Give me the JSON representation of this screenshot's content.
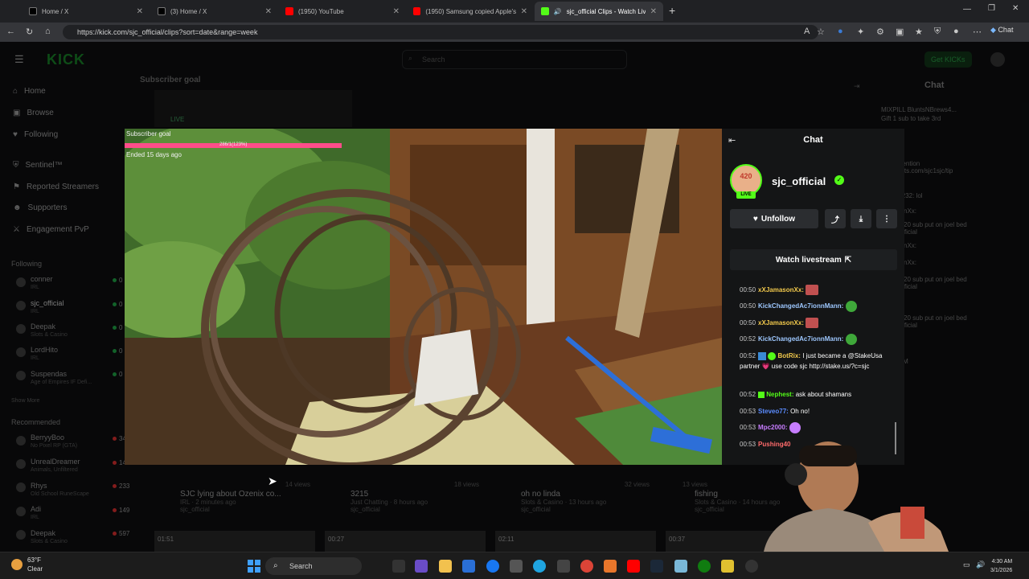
{
  "browser": {
    "tabs": [
      {
        "label": "Home / X"
      },
      {
        "label": "(3) Home / X"
      },
      {
        "label": "(1950) YouTube"
      },
      {
        "label": "(1950) Samsung copied Apple's w"
      },
      {
        "label": "sjc_official Clips - Watch Live"
      }
    ],
    "url": "https://kick.com/sjc_official/clips?sort=date&range=week",
    "chat_button": "Chat"
  },
  "kick": {
    "logo": "KICK",
    "search_placeholder": "Search",
    "get_kicks": "Get KICKs",
    "nav": [
      {
        "label": "Home"
      },
      {
        "label": "Browse"
      },
      {
        "label": "Following"
      },
      {
        "label": "Sentinel™"
      },
      {
        "label": "Reported Streamers"
      },
      {
        "label": "Supporters"
      },
      {
        "label": "Engagement PvP"
      }
    ],
    "following_header": "Following",
    "following": [
      {
        "name": "conner",
        "sub": "IRL",
        "count": "0"
      },
      {
        "name": "sjc_official",
        "sub": "IRL",
        "count": "0"
      },
      {
        "name": "Deepak",
        "sub": "Slots & Casino",
        "count": "0"
      },
      {
        "name": "LordHito",
        "sub": "IRL",
        "count": "0"
      },
      {
        "name": "Suspendas",
        "sub": "Age of Empires IF Defi...",
        "count": "0"
      }
    ],
    "show_more": "Show More",
    "recommended_header": "Recommended",
    "recommended": [
      {
        "name": "BerryyBoo",
        "sub": "No Pixel RP (GTA)",
        "count": "34"
      },
      {
        "name": "UnrealDreamer",
        "sub": "Animals, Unfiltered",
        "count": "14"
      },
      {
        "name": "Rhys",
        "sub": "Old School RuneScape",
        "count": "233"
      },
      {
        "name": "Adi",
        "sub": "IRL",
        "count": "149"
      },
      {
        "name": "Deepak",
        "sub": "Slots & Casino",
        "count": "597"
      }
    ],
    "subscriber_goal": "Subscriber goal",
    "live_badge": "LIVE",
    "right_chat_title": "Chat",
    "clips": [
      {
        "title": "SJC lying about Ozenix co...",
        "meta": "IRL · 2 minutes ago",
        "channel": "sjc_official",
        "views": "14 views",
        "duration": "01:51"
      },
      {
        "title": "3215",
        "meta": "Just Chatting · 8 hours ago",
        "channel": "sjc_official",
        "views": "18 views",
        "duration": "00:27"
      },
      {
        "title": "oh no linda",
        "meta": "Slots & Casino · 13 hours ago",
        "channel": "sjc_official",
        "views": "32 views",
        "duration": "02:11"
      },
      {
        "title": "fishing",
        "meta": "Slots & Casino · 14 hours ago",
        "channel": "sjc_official",
        "views": "13 views",
        "duration": "00:37"
      }
    ],
    "right_chat_lines": [
      {
        "text": "MIXPILL  BluntsNBrews4..."
      },
      {
        "text": "Gift 1 sub to take 3rd"
      },
      {
        "text": "BotRix:"
      },
      {
        "text": "sjc's attention"
      },
      {
        "text": "relements.com/sjc1sjc/tip"
      },
      {
        "text": "CGmer232: lol"
      },
      {
        "text": "JamesonXx:"
      },
      {
        "text": "R0004: 20 sub put on joel bed"
      },
      {
        "text": "@sjc_official"
      },
      {
        "text": "JamesonXx:"
      },
      {
        "text": "JamesonXx:"
      },
      {
        "text": "R0004: 20 sub put on joel bed"
      },
      {
        "text": "@sjc_official"
      },
      {
        "text": "R0004: 20 sub put on joel bed"
      },
      {
        "text": "@sjc_official"
      },
      {
        "text": "04:30 AM"
      }
    ]
  },
  "player": {
    "overlay_goal": "Subscriber goal",
    "overlay_progress": "286/1(123%)",
    "overlay_ended": "Ended 15 days ago",
    "progress_fraction": 1.0
  },
  "chat": {
    "title": "Chat",
    "channel": "sjc_official",
    "live": "LIVE",
    "avatar_text": "420",
    "unfollow": "Unfollow",
    "watch_livestream": "Watch livestream",
    "messages": [
      {
        "time": "00:50",
        "user": "xXJamasonXx:",
        "text": "",
        "user_color": "#f2c94c",
        "emote": "red"
      },
      {
        "time": "00:50",
        "user": "KickChangedAc7ionnMann:",
        "text": "",
        "user_color": "#9ec8ff",
        "emote": "green"
      },
      {
        "time": "00:50",
        "user": "xXJamasonXx:",
        "text": "",
        "user_color": "#f2c94c",
        "emote": "red"
      },
      {
        "time": "00:52",
        "user": "KickChangedAc7ionnMann:",
        "text": "",
        "user_color": "#9ec8ff",
        "emote": "green"
      },
      {
        "time": "00:52",
        "user": "BotRix:",
        "text": "I just became a @StakeUsa partner 💗 use code sjc http://stake.us/?c=sjc",
        "user_color": "#f2c94c",
        "emote": ""
      },
      {
        "time": "00:52",
        "user": "Nephest:",
        "text": "ask about shamans",
        "user_color": "#53fc18",
        "emote": ""
      },
      {
        "time": "00:53",
        "user": "Steveo77:",
        "text": "Oh no!",
        "user_color": "#5b8cff",
        "emote": ""
      },
      {
        "time": "00:53",
        "user": "Mpc2000:",
        "text": "",
        "user_color": "#c77dff",
        "emote": "purple"
      },
      {
        "time": "00:53",
        "user": "Pushing40",
        "text": "",
        "user_color": "#ff6b6b",
        "emote": ""
      }
    ]
  },
  "taskbar": {
    "temp": "63°F",
    "weather": "Clear",
    "search": "Search",
    "time": "4:30 AM",
    "date": "3/1/2026"
  }
}
